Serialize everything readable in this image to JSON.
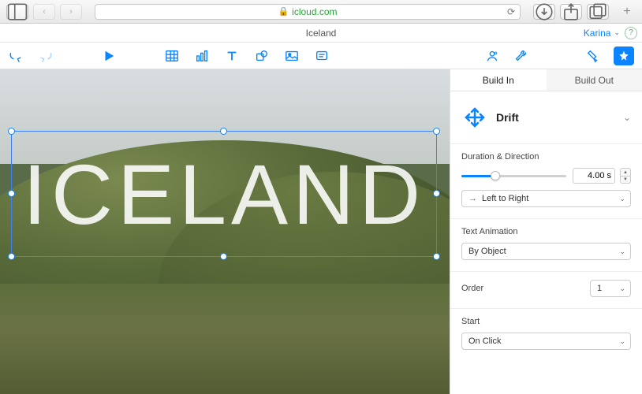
{
  "browser": {
    "url": "icloud.com"
  },
  "doc": {
    "title": "Iceland",
    "user": "Karina"
  },
  "canvas": {
    "text": "ICELAND"
  },
  "inspector": {
    "tabs": {
      "in": "Build In",
      "out": "Build Out"
    },
    "effect": "Drift",
    "duration": {
      "label": "Duration & Direction",
      "value": "4.00 s"
    },
    "direction": "Left to Right",
    "textanim": {
      "label": "Text Animation",
      "value": "By Object"
    },
    "order": {
      "label": "Order",
      "value": "1"
    },
    "start": {
      "label": "Start",
      "value": "On Click"
    }
  }
}
